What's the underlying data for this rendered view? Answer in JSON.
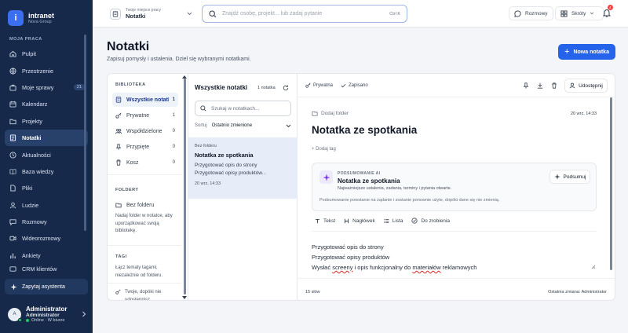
{
  "brand": {
    "name": "intranet",
    "sub": "Nova Group",
    "logo_letter": "i"
  },
  "sidebar": {
    "section": "MOJA PRACA",
    "items": [
      {
        "label": "Pulpit",
        "icon": "home-icon"
      },
      {
        "label": "Przestrzenie",
        "icon": "globe-icon"
      },
      {
        "label": "Moje sprawy",
        "icon": "briefcase-icon",
        "badge": "21"
      },
      {
        "label": "Kalendarz",
        "icon": "calendar-icon"
      },
      {
        "label": "Projekty",
        "icon": "folder-icon"
      },
      {
        "label": "Notatki",
        "icon": "note-icon",
        "active": true
      },
      {
        "label": "Aktualności",
        "icon": "news-icon"
      },
      {
        "label": "Baza wiedzy",
        "icon": "book-icon"
      },
      {
        "label": "Pliki",
        "icon": "file-icon"
      },
      {
        "label": "Ludzie",
        "icon": "people-icon"
      },
      {
        "label": "Rozmowy",
        "icon": "chat-icon"
      },
      {
        "label": "Wideorozmowy",
        "icon": "video-icon"
      },
      {
        "label": "Ankiety",
        "icon": "chart-icon"
      },
      {
        "label": "CRM klientów",
        "icon": "crm-icon"
      }
    ],
    "assistant": "Zapytaj asystenta",
    "user": {
      "name": "Administrator",
      "role": "Administrator",
      "status": "Online · W biurze",
      "initial": "A"
    }
  },
  "topbar": {
    "workspace_label": "Twoje miejsce pracy",
    "workspace_value": "Notatki",
    "search_placeholder": "Znajdź osobę, projekt... lub zadaj pytanie",
    "search_shortcut": "Ctrl K",
    "chats_label": "Rozmowy",
    "shortcuts_label": "Skróty",
    "notifications_count": "4"
  },
  "page": {
    "title": "Notatki",
    "subtitle": "Zapisuj pomysły i ustalenia. Dziel się wybranymi notatkami.",
    "new_note": "Nowa notatka"
  },
  "library": {
    "heading": "BIBLIOTEKA",
    "items": [
      {
        "label": "Wszystkie notatki",
        "count": "1",
        "icon": "notes-icon",
        "active": true
      },
      {
        "label": "Prywatne",
        "count": "1",
        "icon": "key-icon"
      },
      {
        "label": "Współdzielone",
        "count": "0",
        "icon": "people-icon"
      },
      {
        "label": "Przypięte",
        "count": "0",
        "icon": "pin-icon"
      },
      {
        "label": "Kosz",
        "count": "0",
        "icon": "trash-icon"
      }
    ],
    "folders_heading": "FOLDERY",
    "no_folder": "Bez folderu",
    "folders_hint": "Nadaj folder w notatce, aby uporządkować swoją bibliotekę.",
    "tags_heading": "TAGI",
    "tags_hint": "Łącz tematy tagami, niezależnie od folderu.",
    "private_hint": "Twoje, dopóki nie udostępnisz"
  },
  "notes_list": {
    "title": "Wszystkie notatki",
    "count": "1 notatka",
    "search_placeholder": "Szukaj w notatkach...",
    "sort_label": "Sortuj",
    "sort_value": "Ostatnio zmienione",
    "notes": [
      {
        "folder": "Bez folderu",
        "title": "Notatka ze spotkania",
        "line1": "Przygotować opis do strony",
        "line2": "Przygotować opisy produktów...",
        "time": "20 wrz, 14:33"
      }
    ]
  },
  "editor": {
    "visibility": "Prywatna",
    "save_status": "Zapisano",
    "share": "Udostępnij",
    "add_folder": "Dodaj folder",
    "date": "20 wrz, 14:33",
    "title": "Notatka ze spotkania",
    "add_tag": "+ Dodaj tag",
    "ai": {
      "label": "PODSUMOWANIE AI",
      "title": "Notatka ze spotkania",
      "subtitle": "Najważniejsze ustalenia, zadania, terminy i pytania otwarte.",
      "note": "Podsumowanie powstanie na żądanie i zostanie ponownie użyte, dopóki dane się nie zmienią.",
      "button": "Podsumuj"
    },
    "toolbar": [
      "Tekst",
      "Nagłówek",
      "Lista",
      "Do zrobienia"
    ],
    "body": {
      "line1": "Przygotować opis do strony",
      "line2": "Przygotować opisy produktów",
      "line3_a": "Wysłać ",
      "line3_b": "screeny",
      "line3_c": " i opis funkcjonalny do ",
      "line3_d": "materiałów",
      "line3_e": " reklamowych"
    },
    "words": "15 słów",
    "last_change": "Ostatnia zmiana: Administrator"
  },
  "colors": {
    "sidebar": "#16294a",
    "accent": "#2563eb",
    "selected_note": "#e6edf9"
  }
}
